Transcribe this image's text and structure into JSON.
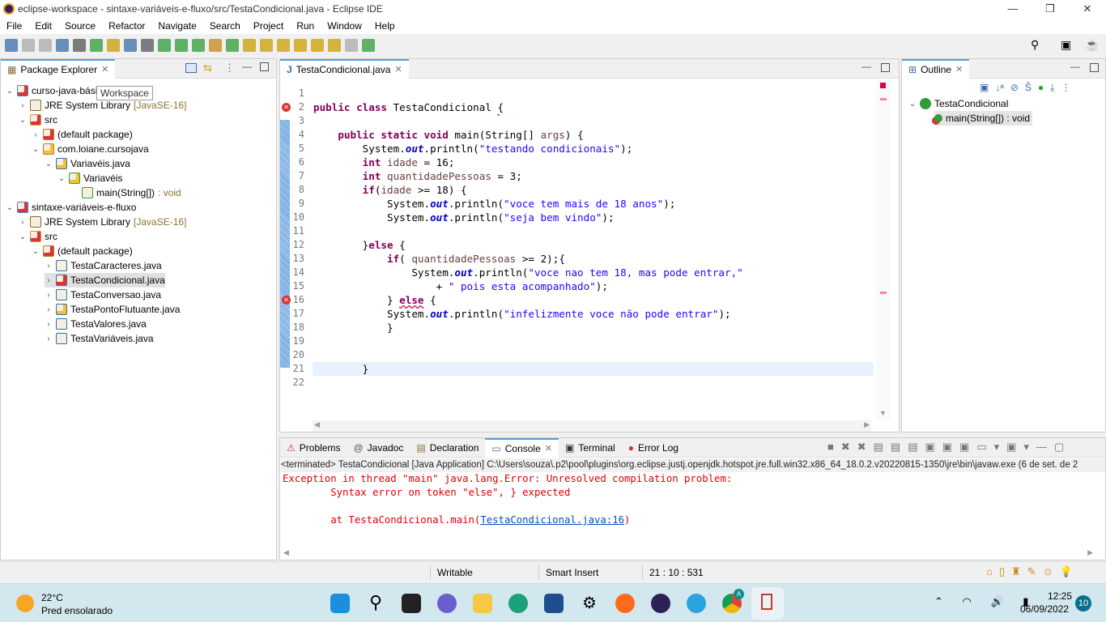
{
  "window": {
    "title": "eclipse-workspace - sintaxe-variáveis-e-fluxo/src/TestaCondicional.java - Eclipse IDE",
    "controls": [
      "—",
      "❐",
      "✕"
    ]
  },
  "menu": [
    "File",
    "Edit",
    "Source",
    "Refactor",
    "Navigate",
    "Search",
    "Project",
    "Run",
    "Window",
    "Help"
  ],
  "package_explorer": {
    "title": "Package Explorer",
    "tooltip": "Workspace",
    "items": [
      {
        "label": "curso-java-básico",
        "suffix": "",
        "depth": 0,
        "expanded": true,
        "icon": "project-error-icon"
      },
      {
        "label": "JRE System Library",
        "suffix": "[JavaSE-16]",
        "depth": 1,
        "expanded": false,
        "icon": "library-icon"
      },
      {
        "label": "src",
        "suffix": "",
        "depth": 1,
        "expanded": true,
        "icon": "source-folder-error-icon"
      },
      {
        "label": "(default package)",
        "suffix": "",
        "depth": 2,
        "expanded": false,
        "icon": "package-error-icon"
      },
      {
        "label": "com.loiane.cursojava",
        "suffix": "",
        "depth": 2,
        "expanded": true,
        "icon": "package-warning-icon"
      },
      {
        "label": "Variavéis.java",
        "suffix": "",
        "depth": 3,
        "expanded": true,
        "icon": "java-file-warning-icon"
      },
      {
        "label": "Variavéis",
        "suffix": "",
        "depth": 4,
        "expanded": true,
        "icon": "class-warning-icon"
      },
      {
        "label": "main(String[])",
        "suffix": ": void",
        "depth": 5,
        "expanded": null,
        "icon": "method-static-icon"
      },
      {
        "label": "sintaxe-variáveis-e-fluxo",
        "suffix": "",
        "depth": 0,
        "expanded": true,
        "icon": "project-error-icon"
      },
      {
        "label": "JRE System Library",
        "suffix": "[JavaSE-16]",
        "depth": 1,
        "expanded": false,
        "icon": "library-icon"
      },
      {
        "label": "src",
        "suffix": "",
        "depth": 1,
        "expanded": true,
        "icon": "source-folder-error-icon"
      },
      {
        "label": "(default package)",
        "suffix": "",
        "depth": 2,
        "expanded": true,
        "icon": "package-error-icon"
      },
      {
        "label": "TestaCaracteres.java",
        "suffix": "",
        "depth": 3,
        "expanded": false,
        "icon": "java-file-icon"
      },
      {
        "label": "TestaCondicional.java",
        "suffix": "",
        "depth": 3,
        "expanded": false,
        "icon": "java-file-error-icon",
        "selected": true
      },
      {
        "label": "TestaConversao.java",
        "suffix": "",
        "depth": 3,
        "expanded": false,
        "icon": "java-file-icon"
      },
      {
        "label": "TestaPontoFlutuante.java",
        "suffix": "",
        "depth": 3,
        "expanded": false,
        "icon": "java-file-warning-icon"
      },
      {
        "label": "TestaValores.java",
        "suffix": "",
        "depth": 3,
        "expanded": false,
        "icon": "java-file-icon"
      },
      {
        "label": "TestaVariáveis.java",
        "suffix": "",
        "depth": 3,
        "expanded": false,
        "icon": "java-file-icon"
      }
    ]
  },
  "editor": {
    "tab": "TestaCondicional.java",
    "lines": [
      {
        "n": "1",
        "seg": []
      },
      {
        "n": "2",
        "err": true,
        "seg": [
          {
            "c": "kw",
            "v": "public class"
          },
          {
            "c": "",
            "v": " TestaCondicional "
          },
          {
            "c": "err",
            "v": "{"
          }
        ]
      },
      {
        "n": "3",
        "seg": []
      },
      {
        "n": "4",
        "seg": [
          {
            "c": "",
            "v": "    "
          },
          {
            "c": "kw",
            "v": "public static void"
          },
          {
            "c": "",
            "v": " main(String[] "
          },
          {
            "c": "var",
            "v": "args"
          },
          {
            "c": "",
            "v": ") {"
          }
        ]
      },
      {
        "n": "5",
        "seg": [
          {
            "c": "",
            "v": "        System."
          },
          {
            "c": "fld",
            "v": "out"
          },
          {
            "c": "",
            "v": ".println("
          },
          {
            "c": "str",
            "v": "\"testando condicionais\""
          },
          {
            "c": "",
            "v": ");"
          }
        ]
      },
      {
        "n": "6",
        "seg": [
          {
            "c": "",
            "v": "        "
          },
          {
            "c": "kw",
            "v": "int"
          },
          {
            "c": "",
            "v": " "
          },
          {
            "c": "var",
            "v": "idade"
          },
          {
            "c": "",
            "v": " = 16;"
          }
        ]
      },
      {
        "n": "7",
        "seg": [
          {
            "c": "",
            "v": "        "
          },
          {
            "c": "kw",
            "v": "int"
          },
          {
            "c": "",
            "v": " "
          },
          {
            "c": "var",
            "v": "quantidadePessoas"
          },
          {
            "c": "",
            "v": " = 3;"
          }
        ]
      },
      {
        "n": "8",
        "seg": [
          {
            "c": "",
            "v": "        "
          },
          {
            "c": "kw",
            "v": "if"
          },
          {
            "c": "",
            "v": "("
          },
          {
            "c": "var",
            "v": "idade"
          },
          {
            "c": "",
            "v": " >= 18) {"
          }
        ]
      },
      {
        "n": "9",
        "seg": [
          {
            "c": "",
            "v": "            System."
          },
          {
            "c": "fld",
            "v": "out"
          },
          {
            "c": "",
            "v": ".println("
          },
          {
            "c": "str",
            "v": "\"voce tem mais de 18 anos\""
          },
          {
            "c": "",
            "v": ");"
          }
        ]
      },
      {
        "n": "10",
        "seg": [
          {
            "c": "",
            "v": "            System."
          },
          {
            "c": "fld",
            "v": "out"
          },
          {
            "c": "",
            "v": ".println("
          },
          {
            "c": "str",
            "v": "\"seja bem vindo\""
          },
          {
            "c": "",
            "v": ");"
          }
        ]
      },
      {
        "n": "11",
        "seg": []
      },
      {
        "n": "12",
        "seg": [
          {
            "c": "",
            "v": "        }"
          },
          {
            "c": "kw",
            "v": "else"
          },
          {
            "c": "",
            "v": " {"
          }
        ]
      },
      {
        "n": "13",
        "seg": [
          {
            "c": "",
            "v": "            "
          },
          {
            "c": "kw",
            "v": "if"
          },
          {
            "c": "",
            "v": "( "
          },
          {
            "c": "var",
            "v": "quantidadePessoas"
          },
          {
            "c": "",
            "v": " >= 2);{"
          }
        ]
      },
      {
        "n": "14",
        "seg": [
          {
            "c": "",
            "v": "                System."
          },
          {
            "c": "fld",
            "v": "out"
          },
          {
            "c": "",
            "v": ".println("
          },
          {
            "c": "str",
            "v": "\"voce nao tem 18, mas pode entrar,\""
          }
        ]
      },
      {
        "n": "15",
        "seg": [
          {
            "c": "",
            "v": "                    + "
          },
          {
            "c": "str",
            "v": "\" pois esta acompanhado\""
          },
          {
            "c": "",
            "v": ");"
          }
        ]
      },
      {
        "n": "16",
        "err": true,
        "seg": [
          {
            "c": "",
            "v": "            } "
          },
          {
            "c": "kw err",
            "v": "else"
          },
          {
            "c": "",
            "v": " {"
          }
        ]
      },
      {
        "n": "17",
        "seg": [
          {
            "c": "",
            "v": "            System."
          },
          {
            "c": "fld",
            "v": "out"
          },
          {
            "c": "",
            "v": ".println("
          },
          {
            "c": "str",
            "v": "\"infelizmente voce não pode entrar\""
          },
          {
            "c": "",
            "v": ");"
          }
        ]
      },
      {
        "n": "18",
        "seg": [
          {
            "c": "",
            "v": "            }"
          }
        ]
      },
      {
        "n": "19",
        "seg": []
      },
      {
        "n": "20",
        "seg": []
      },
      {
        "n": "21",
        "current": true,
        "seg": [
          {
            "c": "",
            "v": "        }"
          }
        ]
      },
      {
        "n": "22",
        "seg": []
      }
    ]
  },
  "outline": {
    "title": "Outline",
    "items": [
      {
        "label": "TestaCondicional",
        "icon": "class-icon"
      },
      {
        "label": "main(String[]) : void",
        "icon": "method-static-error-icon"
      }
    ]
  },
  "bottom": {
    "tabs": [
      "Problems",
      "Javadoc",
      "Declaration",
      "Console",
      "Terminal",
      "Error Log"
    ],
    "active": "Console",
    "header": "<terminated> TestaCondicional [Java Application] C:\\Users\\souza\\.p2\\pool\\plugins\\org.eclipse.justj.openjdk.hotspot.jre.full.win32.x86_64_18.0.2.v20220815-1350\\jre\\bin\\javaw.exe  (6 de set. de 2",
    "console": {
      "line1": "Exception in thread \"main\" java.lang.Error: Unresolved compilation problem: ",
      "line2": "\tSyntax error on token \"else\", } expected",
      "line3_prefix": "\tat TestaCondicional.main(",
      "line3_link": "TestaCondicional.java:16",
      "line3_suffix": ")",
      "color": "#e00000"
    }
  },
  "status": {
    "writable": "Writable",
    "insert_mode": "Smart Insert",
    "position": "21 : 10 : 531"
  },
  "taskbar": {
    "weather_temp": "22°C",
    "weather_desc": "Pred ensolarado",
    "time": "12:25",
    "date": "06/09/2022",
    "notifications": "10",
    "chrome_badge": "A"
  }
}
